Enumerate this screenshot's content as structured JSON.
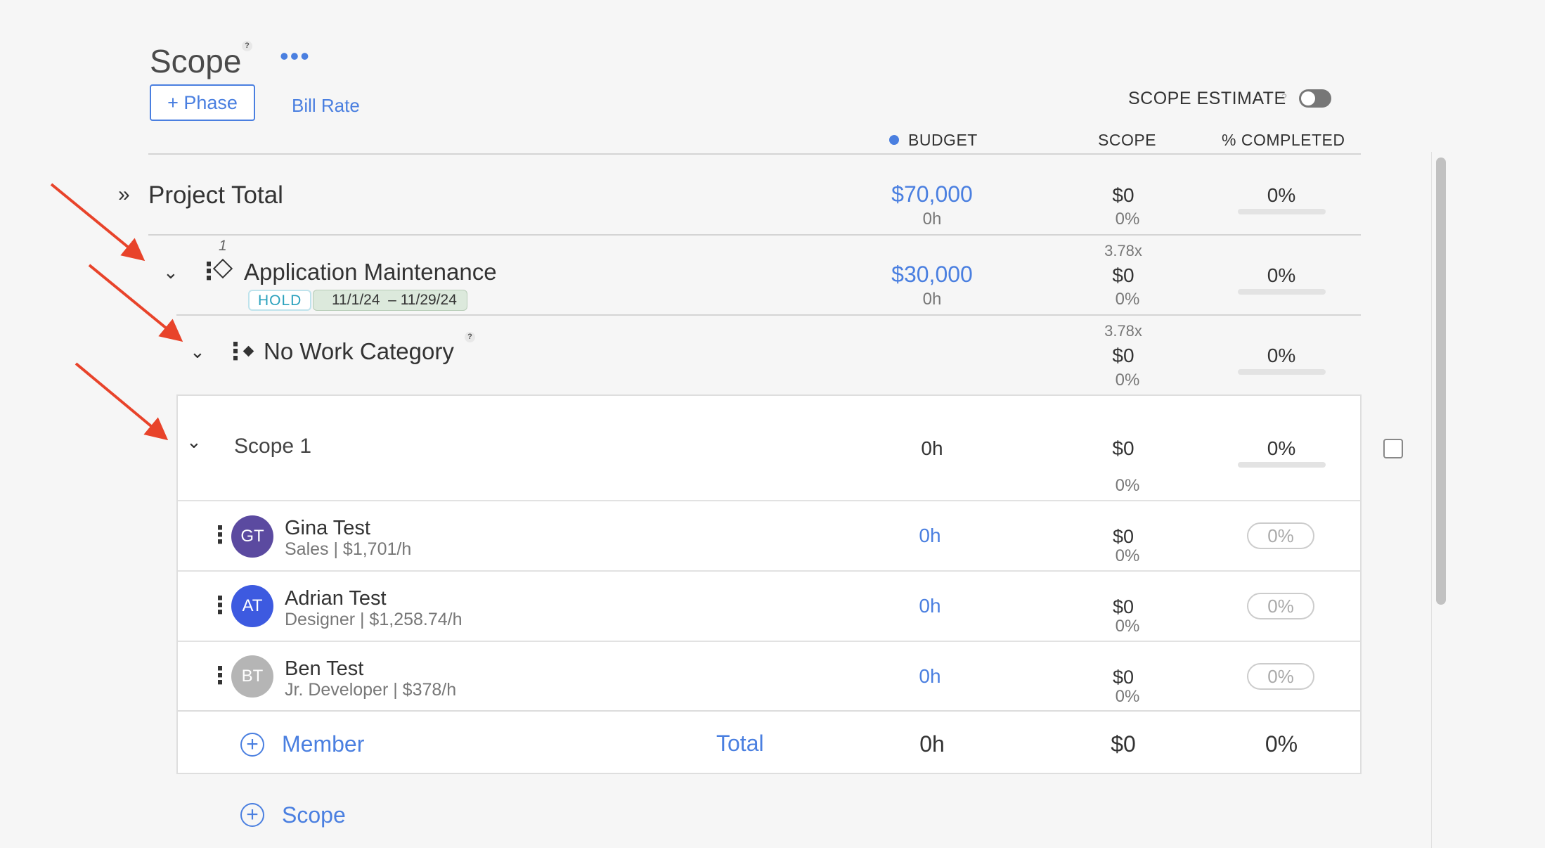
{
  "header": {
    "title": "Scope",
    "help": "?",
    "more": "•••",
    "add_phase": "+ Phase",
    "bill_rate": "Bill Rate",
    "scope_estimate": "SCOPE ESTIMATE",
    "scope_estimate_help": "?",
    "scope_estimate_toggle": false
  },
  "columns": {
    "budget": "BUDGET",
    "scope": "SCOPE",
    "completed": "% COMPLETED",
    "budget_dot_color": "#4a7fe0"
  },
  "project_total": {
    "label": "Project Total",
    "budget": "$70,000",
    "budget_hours": "0h",
    "scope": "$0",
    "scope_pct": "0%",
    "completed": "0%",
    "completed_fraction": 0
  },
  "phase": {
    "number": "1",
    "name": "Application Maintenance",
    "status": "HOLD",
    "dates": "11/1/24  – 11/29/24",
    "multiplier": "3.78x",
    "budget": "$30,000",
    "budget_hours": "0h",
    "scope": "$0",
    "scope_pct": "0%",
    "completed": "0%",
    "completed_fraction": 0
  },
  "work_category": {
    "name": "No Work Category",
    "help": "?",
    "multiplier": "3.78x",
    "scope": "$0",
    "scope_pct": "0%",
    "completed": "0%",
    "completed_fraction": 0
  },
  "scope_item": {
    "name": "Scope 1",
    "hours": "0h",
    "scope": "$0",
    "scope_pct": "0%",
    "completed": "0%",
    "completed_fraction": 0
  },
  "members": [
    {
      "initials": "GT",
      "name": "Gina Test",
      "role": "Sales | $1,701/h",
      "hours": "0h",
      "scope": "$0",
      "scope_pct": "0%",
      "completed": "0%",
      "avatar_color": "#5b4aa0"
    },
    {
      "initials": "AT",
      "name": "Adrian Test",
      "role": "Designer | $1,258.74/h",
      "hours": "0h",
      "scope": "$0",
      "scope_pct": "0%",
      "completed": "0%",
      "avatar_color": "#3d5ae0"
    },
    {
      "initials": "BT",
      "name": "Ben Test",
      "role": "Jr. Developer | $378/h",
      "hours": "0h",
      "scope": "$0",
      "scope_pct": "0%",
      "completed": "0%",
      "avatar_color": "#b5b5b5"
    }
  ],
  "footer": {
    "add_member": "Member",
    "total_label": "Total",
    "total_hours": "0h",
    "total_scope": "$0",
    "total_completed": "0%",
    "add_scope": "Scope"
  },
  "colors": {
    "accent": "#4a7fe0",
    "annotation_arrow": "#e8432a"
  }
}
